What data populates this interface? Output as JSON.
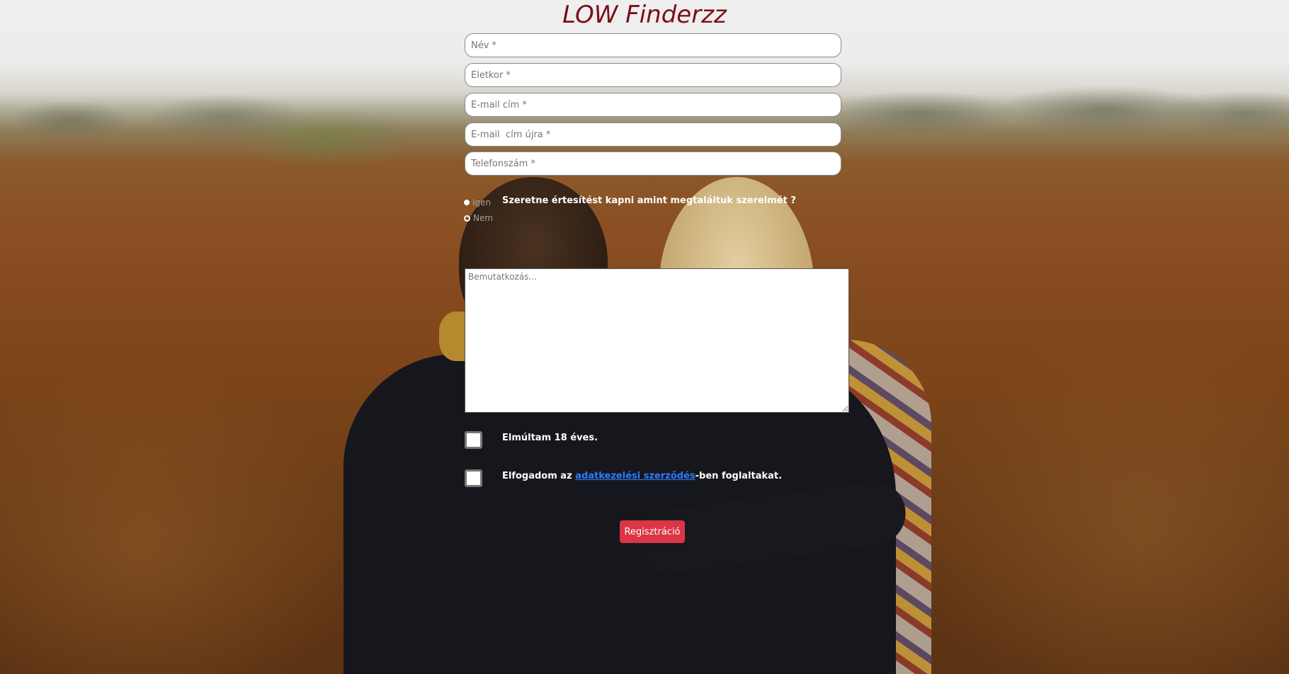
{
  "title": "LOW Finderzz",
  "fields": {
    "name_placeholder": "Név *",
    "age_placeholder": "Életkor *",
    "email_placeholder": "E-mail cím *",
    "email_again_placeholder": "E-mail  cím újra *",
    "phone_placeholder": "Telefonszám *"
  },
  "notify": {
    "question": "Szeretne értesítést kapni amint megtaláltuk szerelmét ?",
    "options": [
      {
        "label": "Igen",
        "selected": true
      },
      {
        "label": "Nem",
        "selected": false
      }
    ]
  },
  "intro": {
    "placeholder": "Bemutatkozás..."
  },
  "checks": {
    "age_label": "Elmúltam 18 éves.",
    "terms_prefix": "Elfogadom az ",
    "terms_link": "adatkezelési szerződés",
    "terms_suffix": "-ben foglaltakat."
  },
  "submit": {
    "label": "Regisztráció"
  },
  "colors": {
    "title": "#7a0f1a",
    "button": "#dc3545",
    "link": "#2f7bff"
  }
}
